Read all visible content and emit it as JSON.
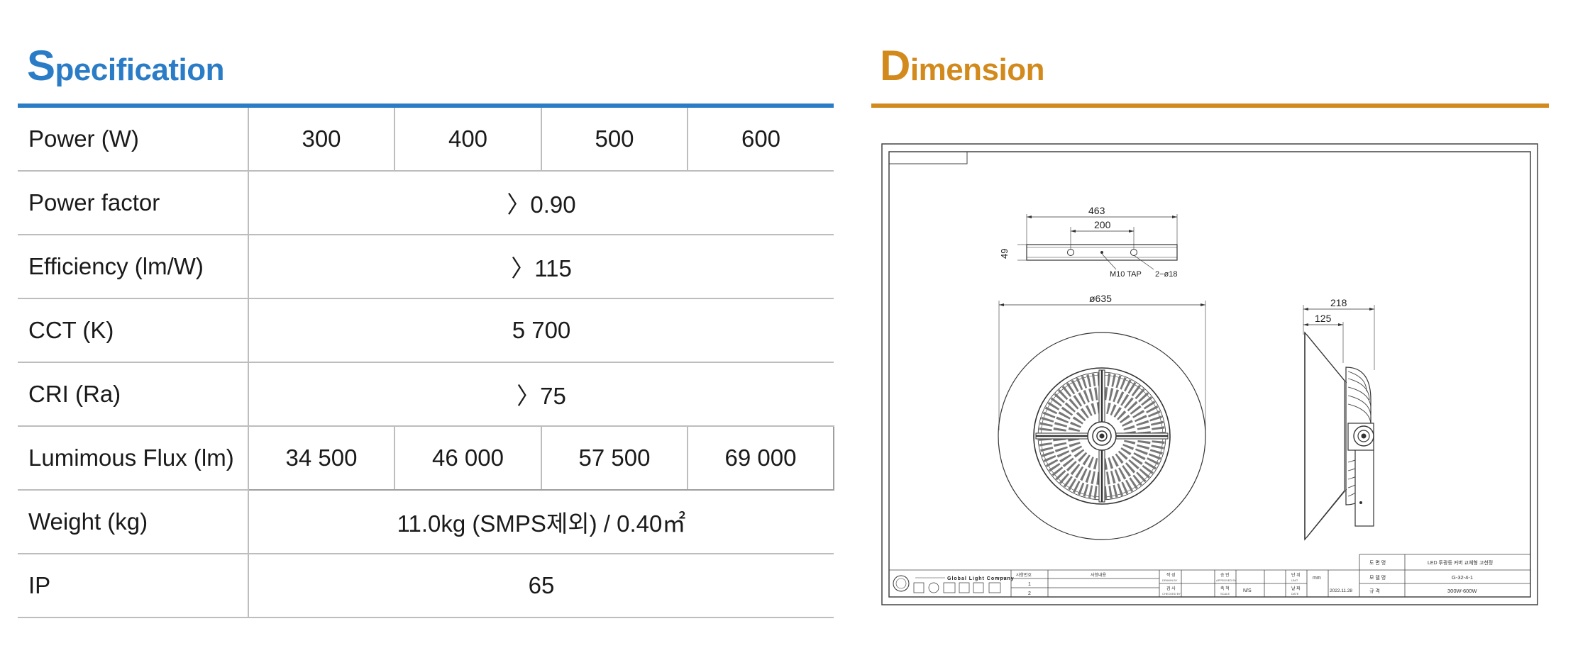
{
  "spec": {
    "title_initial": "S",
    "title_rest": "pecification",
    "rows": [
      {
        "label": "Power (W)",
        "values": [
          "300",
          "400",
          "500",
          "600"
        ]
      },
      {
        "label": "Power factor",
        "value": "〉0.90"
      },
      {
        "label": "Efficiency (lm/W)",
        "value": "〉115"
      },
      {
        "label": "CCT (K)",
        "value": "5 700"
      },
      {
        "label": "CRI (Ra)",
        "value": "〉75"
      },
      {
        "label": "Lumimous Flux (lm)",
        "values": [
          "34 500",
          "46 000",
          "57 500",
          "69 000"
        ]
      },
      {
        "label": "Weight (kg)",
        "value": "11.0kg (SMPS제외) / 0.40㎡"
      },
      {
        "label": "IP",
        "value": "65"
      }
    ],
    "accent_color": "#2b7cc7"
  },
  "dimension": {
    "title_initial": "D",
    "title_rest": "imension",
    "accent_color": "#d28a1d",
    "drawing": {
      "dim_463": "463",
      "dim_200": "200",
      "dim_49": "49",
      "note_tap": "M10  TAP",
      "note_holes": "2−ø18",
      "dim_635": "ø635",
      "dim_218": "218",
      "dim_125": "125",
      "company": "Global Light Company",
      "rev_header_1": "사항번호",
      "rev_header_2": "사항내용",
      "rev_1": "1",
      "rev_2": "2",
      "drawn_ko": "작 성",
      "drawn_en": "DRAWN BY",
      "checked_ko": "검 사",
      "checked_en": "CHECKED BY",
      "approved_ko": "승 인",
      "approved_en": "APPROVED BY",
      "scale_ko": "축 척",
      "scale_en": "SCALE",
      "scale_value": "N/S",
      "unit_ko": "단 위",
      "unit_en": "UNIT",
      "unit_value": "mm",
      "date_ko": "날 짜",
      "date_en": "DATE",
      "date_value": "2022.11.28",
      "dwg_name_label": "도 면 명",
      "dwg_name_value": "LED 투광등 커버 교체형 고천정",
      "model_label": "모 델 명",
      "model_value": "G-32-4-1",
      "spec_label": "규 격",
      "spec_value": "300W-600W"
    }
  }
}
